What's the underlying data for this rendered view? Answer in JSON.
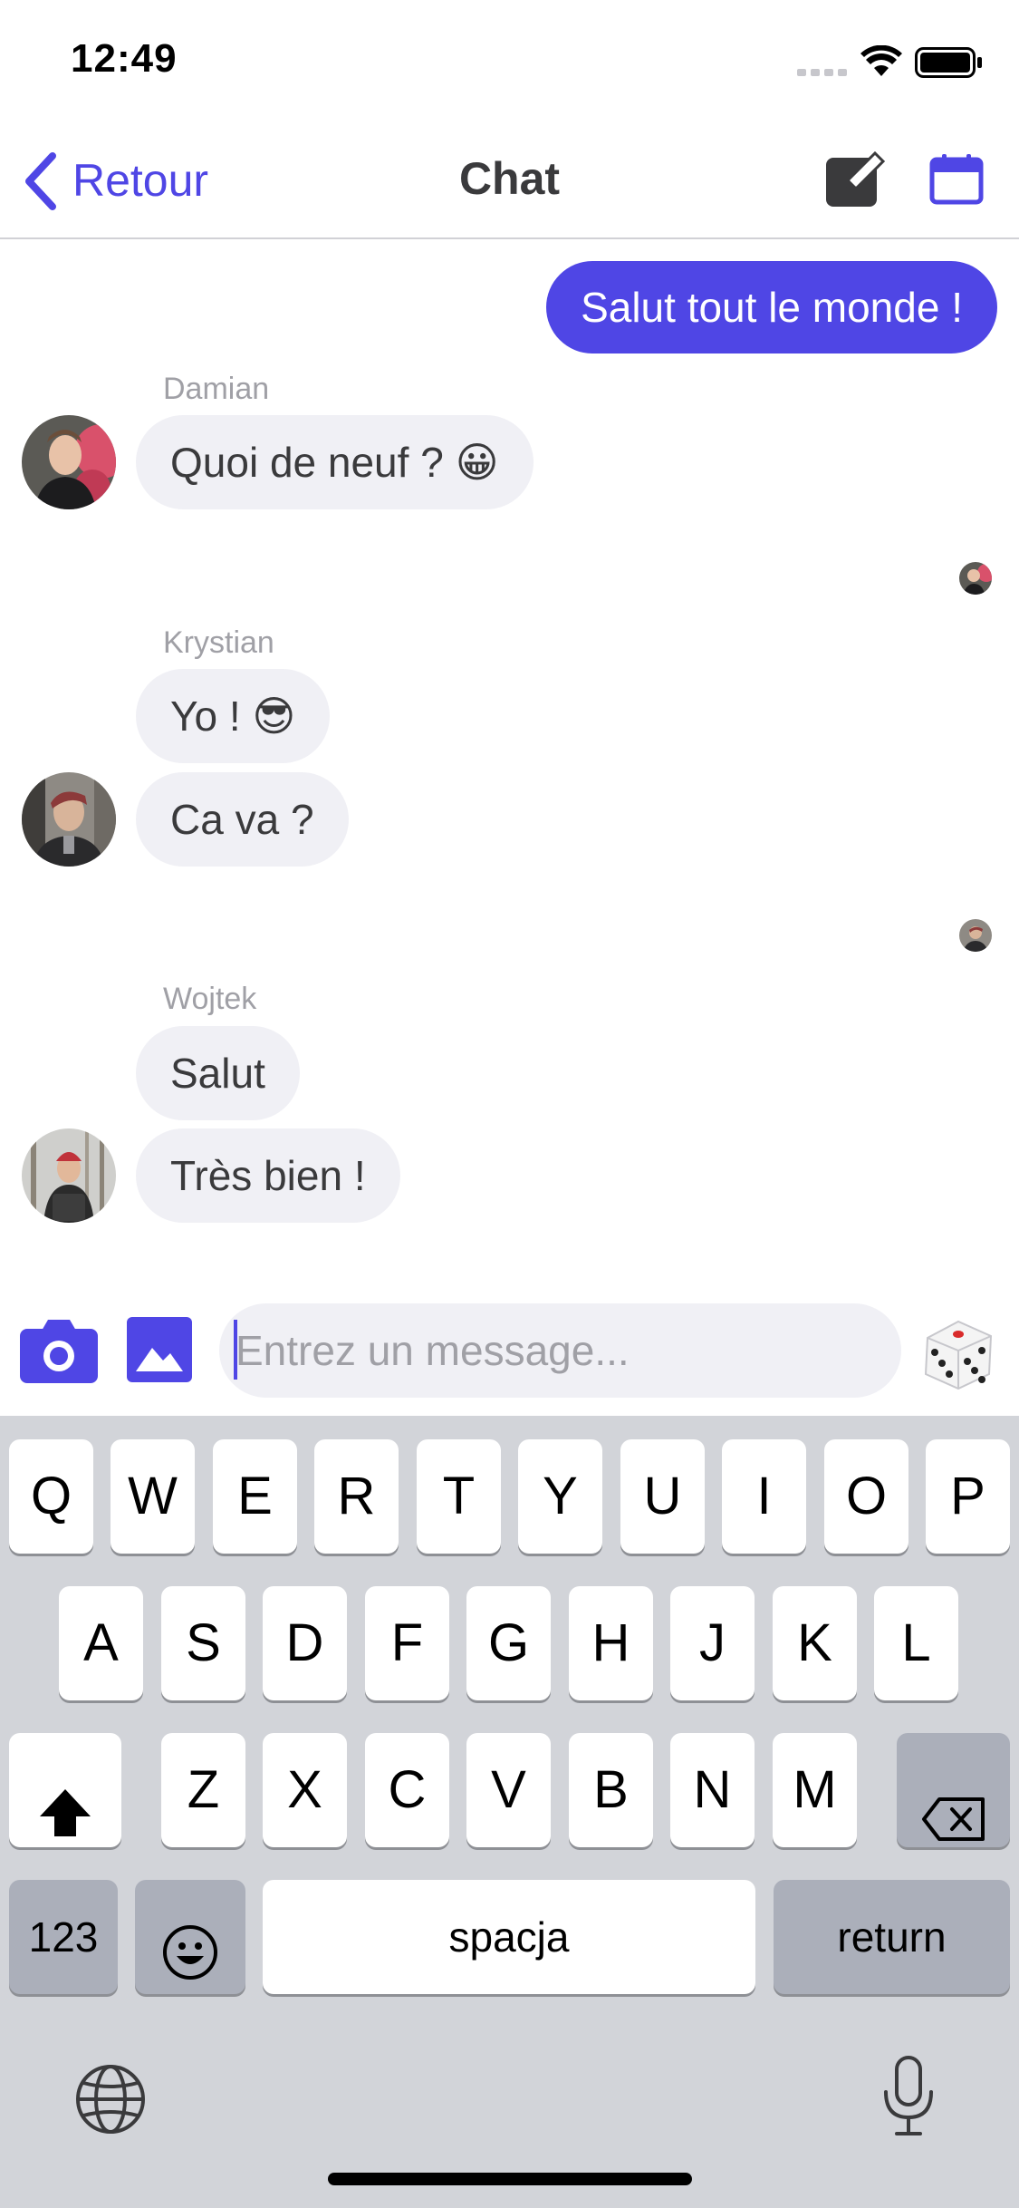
{
  "status_bar": {
    "time": "12:49"
  },
  "nav": {
    "back_label": "Retour",
    "title": "Chat",
    "right_icons": [
      "compose-icon",
      "calendar-icon"
    ]
  },
  "colors": {
    "accent": "#4f46e5",
    "incoming_bubble": "#f0f0f5",
    "keyboard_bg": "#d2d4d9"
  },
  "messages": [
    {
      "direction": "outgoing",
      "text": "Salut tout le monde !"
    },
    {
      "direction": "incoming",
      "sender": "Damian",
      "texts": [
        "Quoi de neuf ? 😀"
      ]
    },
    {
      "direction": "incoming",
      "sender": "Krystian",
      "texts": [
        "Yo ! 😎",
        "Ca va ?"
      ]
    },
    {
      "direction": "incoming",
      "sender": "Wojtek",
      "texts": [
        "Salut",
        "Très bien !"
      ]
    }
  ],
  "composer": {
    "placeholder": "Entrez un message...",
    "left_icons": [
      "camera-icon",
      "image-icon"
    ],
    "right_icon": "dice-icon"
  },
  "keyboard": {
    "row1": [
      "Q",
      "W",
      "E",
      "R",
      "T",
      "Y",
      "U",
      "I",
      "O",
      "P"
    ],
    "row2": [
      "A",
      "S",
      "D",
      "F",
      "G",
      "H",
      "J",
      "K",
      "L"
    ],
    "row3": [
      "Z",
      "X",
      "C",
      "V",
      "B",
      "N",
      "M"
    ],
    "numbers_label": "123",
    "space_label": "spacja",
    "return_label": "return",
    "icons": [
      "shift-icon",
      "backspace-icon",
      "emoji-icon",
      "globe-icon",
      "microphone-icon"
    ]
  }
}
